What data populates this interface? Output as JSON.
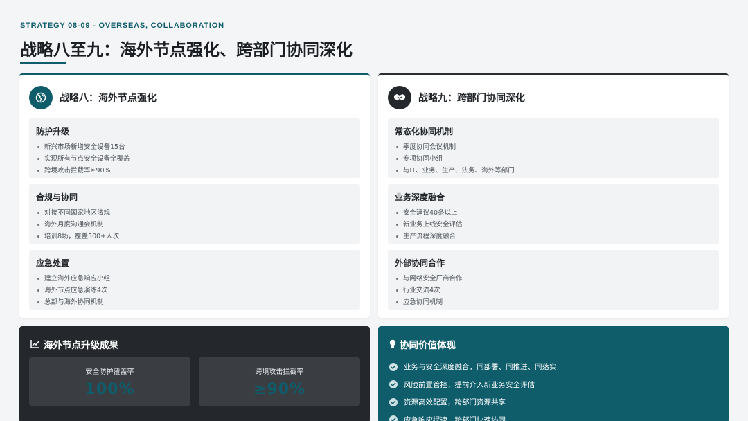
{
  "header": {
    "eyebrow": "STRATEGY 08-09 - OVERSEAS, COLLABORATION",
    "title": "战略八至九：海外节点强化、跨部门协同深化"
  },
  "left_card": {
    "icon": "globe-icon",
    "title": "战略八：海外节点强化",
    "sections": [
      {
        "title": "防护升级",
        "items": [
          "新兴市场新增安全设备15台",
          "实现所有节点安全设备全覆盖",
          "跨境攻击拦截率≥90%"
        ]
      },
      {
        "title": "合规与协同",
        "items": [
          "对接不同国家地区法规",
          "海外月度沟通会机制",
          "培训8场，覆盖500+人次"
        ]
      },
      {
        "title": "应急处置",
        "items": [
          "建立海外应急响应小组",
          "海外节点应急演练4次",
          "总部与海外协同机制"
        ]
      }
    ]
  },
  "right_card": {
    "icon": "handshake-icon",
    "title": "战略九：跨部门协同深化",
    "sections": [
      {
        "title": "常态化协同机制",
        "items": [
          "季度协同会议机制",
          "专项协同小组",
          "与IT、业务、生产、法务、海外等部门"
        ]
      },
      {
        "title": "业务深度融合",
        "items": [
          "安全建议40条以上",
          "新业务上线安全评估",
          "生产流程深度融合"
        ]
      },
      {
        "title": "外部协同合作",
        "items": [
          "与网络安全厂商合作",
          "行业交流4次",
          "应急协同机制"
        ]
      }
    ]
  },
  "results_panel": {
    "icon": "line-chart-icon",
    "title": "海外节点升级成果",
    "stats": [
      {
        "label": "安全防护覆盖率",
        "value": "100%"
      },
      {
        "label": "跨境攻击拦截率",
        "value": "≥90%"
      }
    ]
  },
  "value_panel": {
    "icon": "lightbulb-icon",
    "title": "协同价值体现",
    "items": [
      "业务与安全深度融合，同部署、同推进、同落实",
      "风险前置管控，提前介入新业务安全评估",
      "资源高效配置，跨部门资源共享",
      "应急响应提速，跨部门快速协同"
    ]
  },
  "colors": {
    "accent": "#0f5c6b",
    "dark": "#24272b",
    "background": "#f4f5f7"
  }
}
